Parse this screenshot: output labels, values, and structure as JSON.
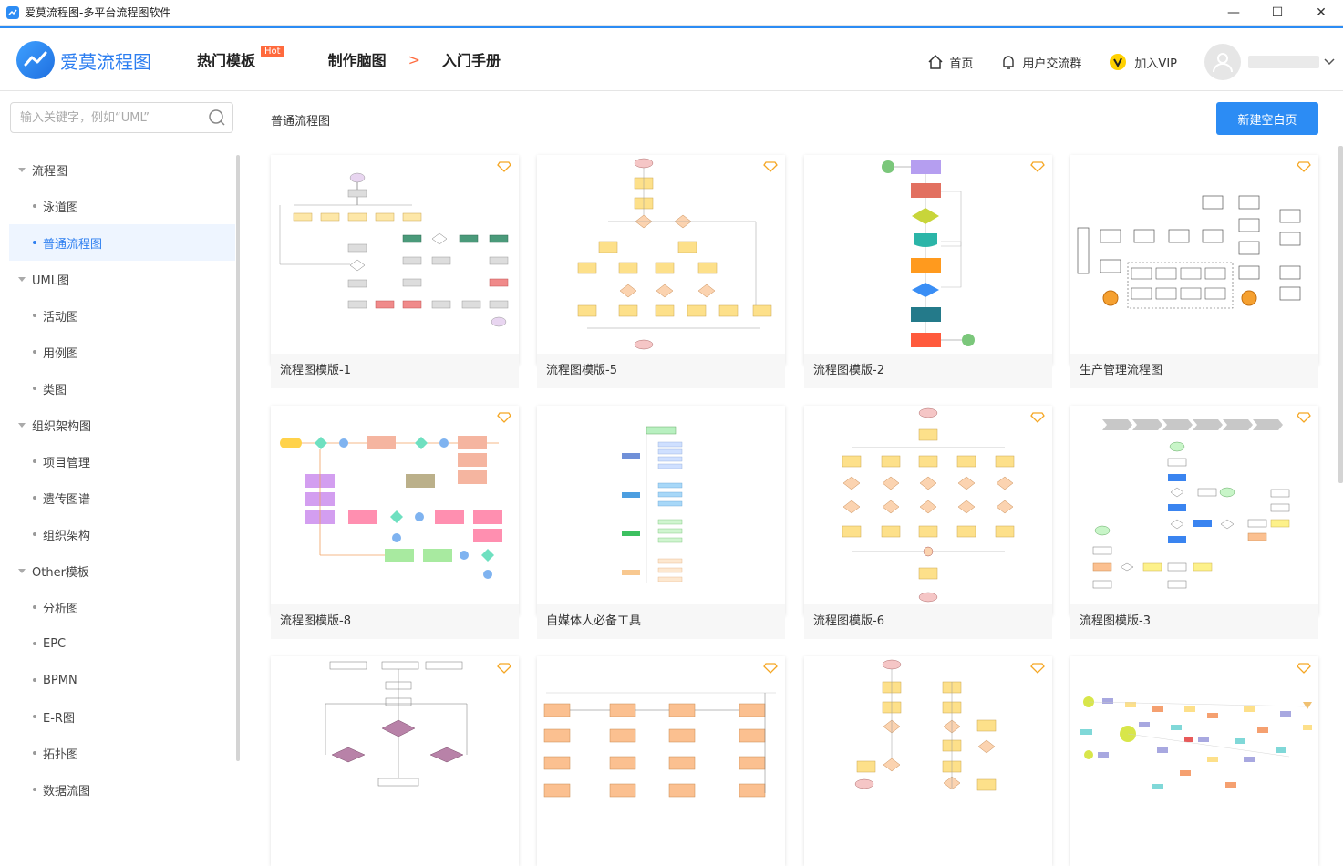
{
  "window": {
    "title": "爱莫流程图-多平台流程图软件",
    "min": "—",
    "max": "☐",
    "close": "✕"
  },
  "header": {
    "logo_text": "爱莫流程图",
    "nav": [
      {
        "label": "热门模板",
        "badge": "Hot"
      },
      {
        "label": "制作脑图"
      },
      {
        "label": "入门手册"
      }
    ],
    "right": {
      "home": "首页",
      "group": "用户交流群",
      "vip": "加入VIP"
    }
  },
  "sidebar": {
    "search_placeholder": "输入关键字，例如“UML”",
    "groups": [
      {
        "label": "流程图",
        "items": [
          "泳道图",
          "普通流程图"
        ]
      },
      {
        "label": "UML图",
        "items": [
          "活动图",
          "用例图",
          "类图"
        ]
      },
      {
        "label": "组织架构图",
        "items": [
          "项目管理",
          "遗传图谱",
          "组织架构"
        ]
      },
      {
        "label": "Other模板",
        "items": [
          "分析图",
          "EPC",
          "BPMN",
          "E-R图",
          "拓扑图",
          "数据流图"
        ]
      }
    ],
    "active_item": "普通流程图"
  },
  "main": {
    "breadcrumb": "普通流程图",
    "new_button": "新建空白页",
    "cards": [
      {
        "title": "流程图模版-1"
      },
      {
        "title": "流程图模版-5"
      },
      {
        "title": "流程图模版-2"
      },
      {
        "title": "生产管理流程图"
      },
      {
        "title": "流程图模版-8"
      },
      {
        "title": "自媒体人必备工具"
      },
      {
        "title": "流程图模版-6"
      },
      {
        "title": "流程图模版-3"
      },
      {
        "title": ""
      },
      {
        "title": ""
      },
      {
        "title": ""
      },
      {
        "title": ""
      }
    ]
  },
  "colors": {
    "accent": "#2c8cf4",
    "vip": "#f5a623",
    "hot": "#ff6a3d"
  }
}
